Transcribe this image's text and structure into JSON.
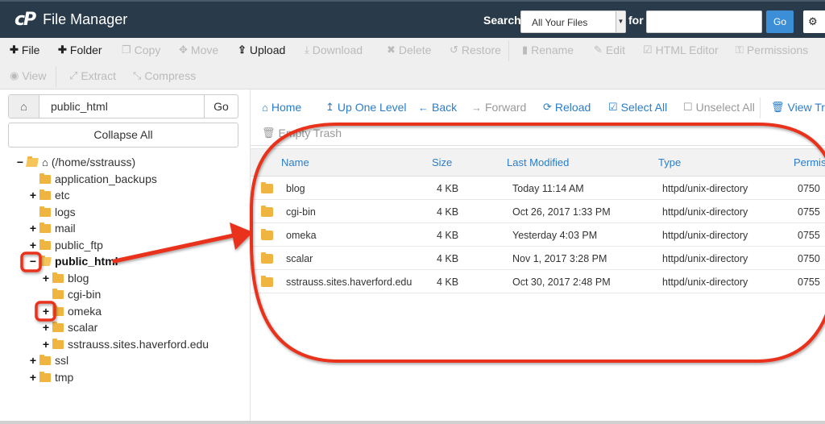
{
  "header": {
    "logo_mark": "cP",
    "title": "File Manager",
    "search_label": "Search",
    "search_scope": "All Your Files",
    "for_label": "for",
    "search_value": "",
    "go_label": "Go",
    "settings_icon": "gear-icon"
  },
  "toolbar": {
    "row1": [
      {
        "label": "File",
        "icon": "plus-icon",
        "enabled": true
      },
      {
        "label": "Folder",
        "icon": "plus-icon",
        "enabled": true
      },
      {
        "label": "Copy",
        "icon": "copy-icon",
        "enabled": false
      },
      {
        "label": "Move",
        "icon": "move-icon",
        "enabled": false
      },
      {
        "label": "Upload",
        "icon": "upload-icon",
        "enabled": true
      },
      {
        "label": "Download",
        "icon": "download-icon",
        "enabled": false
      },
      {
        "label": "Delete",
        "icon": "x-icon",
        "enabled": false
      },
      {
        "label": "Restore",
        "icon": "restore-icon",
        "enabled": false
      },
      {
        "label": "Rename",
        "icon": "file-icon",
        "enabled": false
      },
      {
        "label": "Edit",
        "icon": "pencil-icon",
        "enabled": false
      },
      {
        "label": "HTML Editor",
        "icon": "edit-square-icon",
        "enabled": false
      },
      {
        "label": "Permissions",
        "icon": "key-icon",
        "enabled": false
      }
    ],
    "row2": [
      {
        "label": "View",
        "icon": "eye-icon",
        "enabled": false
      },
      {
        "label": "Extract",
        "icon": "expand-icon",
        "enabled": false
      },
      {
        "label": "Compress",
        "icon": "compress-icon",
        "enabled": false
      }
    ]
  },
  "sidebar": {
    "path_value": "public_html",
    "go_label": "Go",
    "collapse_label": "Collapse All",
    "tree": [
      {
        "label": "(/home/sstrauss)",
        "toggle": "−",
        "level": 0,
        "home": true,
        "open": true
      },
      {
        "label": "application_backups",
        "toggle": "",
        "level": 1
      },
      {
        "label": "etc",
        "toggle": "+",
        "level": 1
      },
      {
        "label": "logs",
        "toggle": "",
        "level": 1
      },
      {
        "label": "mail",
        "toggle": "+",
        "level": 1
      },
      {
        "label": "public_ftp",
        "toggle": "+",
        "level": 1
      },
      {
        "label": "public_html",
        "toggle": "−",
        "level": 1,
        "selected": true,
        "open": true
      },
      {
        "label": "blog",
        "toggle": "+",
        "level": 2
      },
      {
        "label": "cgi-bin",
        "toggle": "",
        "level": 2
      },
      {
        "label": "omeka",
        "toggle": "+",
        "level": 2
      },
      {
        "label": "scalar",
        "toggle": "+",
        "level": 2
      },
      {
        "label": "sstrauss.sites.haverford.edu",
        "toggle": "+",
        "level": 2
      },
      {
        "label": "ssl",
        "toggle": "+",
        "level": 1
      },
      {
        "label": "tmp",
        "toggle": "+",
        "level": 1
      }
    ]
  },
  "nav": {
    "items": [
      {
        "label": "Home",
        "icon": "home-icon",
        "enabled": true
      },
      {
        "label": "Up One Level",
        "icon": "level-up-icon",
        "enabled": true
      },
      {
        "label": "Back",
        "icon": "arrow-left-icon",
        "enabled": true
      },
      {
        "label": "Forward",
        "icon": "arrow-right-icon",
        "enabled": false
      },
      {
        "label": "Reload",
        "icon": "refresh-icon",
        "enabled": true
      },
      {
        "label": "Select All",
        "icon": "checkbox-checked-icon",
        "enabled": true
      },
      {
        "label": "Unselect All",
        "icon": "checkbox-empty-icon",
        "enabled": false
      },
      {
        "label": "View Trash",
        "icon": "trash-icon",
        "enabled": true
      },
      {
        "label": "Empty Trash",
        "icon": "trash-icon",
        "enabled": false
      }
    ]
  },
  "table": {
    "columns": [
      "Name",
      "Size",
      "Last Modified",
      "Type",
      "Permissions"
    ],
    "rows": [
      {
        "name": "blog",
        "size": "4 KB",
        "modified": "Today 11:14 AM",
        "type": "httpd/unix-directory",
        "perms": "0750"
      },
      {
        "name": "cgi-bin",
        "size": "4 KB",
        "modified": "Oct 26, 2017 1:33 PM",
        "type": "httpd/unix-directory",
        "perms": "0755"
      },
      {
        "name": "omeka",
        "size": "4 KB",
        "modified": "Yesterday 4:03 PM",
        "type": "httpd/unix-directory",
        "perms": "0755"
      },
      {
        "name": "scalar",
        "size": "4 KB",
        "modified": "Nov 1, 2017 3:28 PM",
        "type": "httpd/unix-directory",
        "perms": "0750"
      },
      {
        "name": "sstrauss.sites.haverford.edu",
        "size": "4 KB",
        "modified": "Oct 30, 2017 2:48 PM",
        "type": "httpd/unix-directory",
        "perms": "0755"
      }
    ]
  },
  "annotations": {
    "color": "#e8321e"
  }
}
